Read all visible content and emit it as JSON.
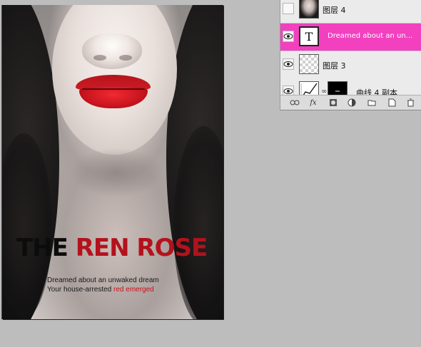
{
  "poster": {
    "title_black": "THE",
    "title_red": "REN ROSE",
    "line1": "Dreamed about an unwaked dream",
    "line2_plain": "Your house-arrested",
    "line2_red": "red emerged",
    "colors": {
      "title_red": "#b3121c",
      "lips": "#d11b25"
    }
  },
  "layers_panel": {
    "layers": [
      {
        "name": "图层 4",
        "visible": false,
        "thumb": "photo-thumbnail",
        "selected": false
      },
      {
        "name": "Dreamed about an un...",
        "visible": true,
        "thumb": "T",
        "selected": true
      },
      {
        "name": "图层 3",
        "visible": true,
        "thumb": "transparent-thumbnail",
        "selected": false
      },
      {
        "name": "曲线 4 副本",
        "visible": true,
        "thumb": "curves-adjustment-thumbnail",
        "selected": false
      }
    ],
    "toolbar_icons": [
      "link-icon",
      "fx-icon",
      "add-mask-icon",
      "adjustment-layer-icon",
      "new-group-icon",
      "new-layer-icon",
      "trash-icon"
    ],
    "selection_color": "#f240bf"
  }
}
